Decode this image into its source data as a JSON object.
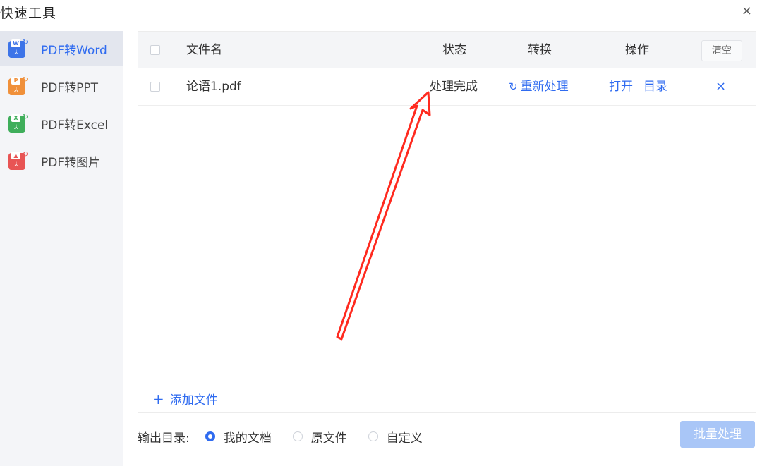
{
  "window": {
    "title": "快速工具",
    "close_glyph": "×"
  },
  "sidebar": {
    "items": [
      {
        "label": "PDF转Word",
        "icon": "pdf-to-word-icon",
        "badge": "W",
        "color": "#3d74e8",
        "active": true
      },
      {
        "label": "PDF转PPT",
        "icon": "pdf-to-ppt-icon",
        "badge": "P",
        "color": "#f0903a",
        "active": false
      },
      {
        "label": "PDF转Excel",
        "icon": "pdf-to-excel-icon",
        "badge": "X",
        "color": "#3fae5b",
        "active": false
      },
      {
        "label": "PDF转图片",
        "icon": "pdf-to-image-icon",
        "badge": "▲",
        "color": "#e85454",
        "active": false
      }
    ]
  },
  "table": {
    "headers": {
      "filename": "文件名",
      "status": "状态",
      "convert": "转换",
      "actions": "操作",
      "clear": "清空"
    },
    "rows": [
      {
        "filename": "论语1.pdf",
        "status": "处理完成",
        "reprocess": "重新处理",
        "open": "打开",
        "folder": "目录",
        "delete": "×"
      }
    ],
    "add_file": "添加文件"
  },
  "output": {
    "label": "输出目录:",
    "options": [
      {
        "label": "我的文档",
        "selected": true
      },
      {
        "label": "原文件",
        "selected": false
      },
      {
        "label": "自定义",
        "selected": false
      }
    ]
  },
  "batch_button": "批量处理",
  "colors": {
    "accent": "#2f6bf0",
    "annotation_arrow": "#ff2a1f"
  }
}
